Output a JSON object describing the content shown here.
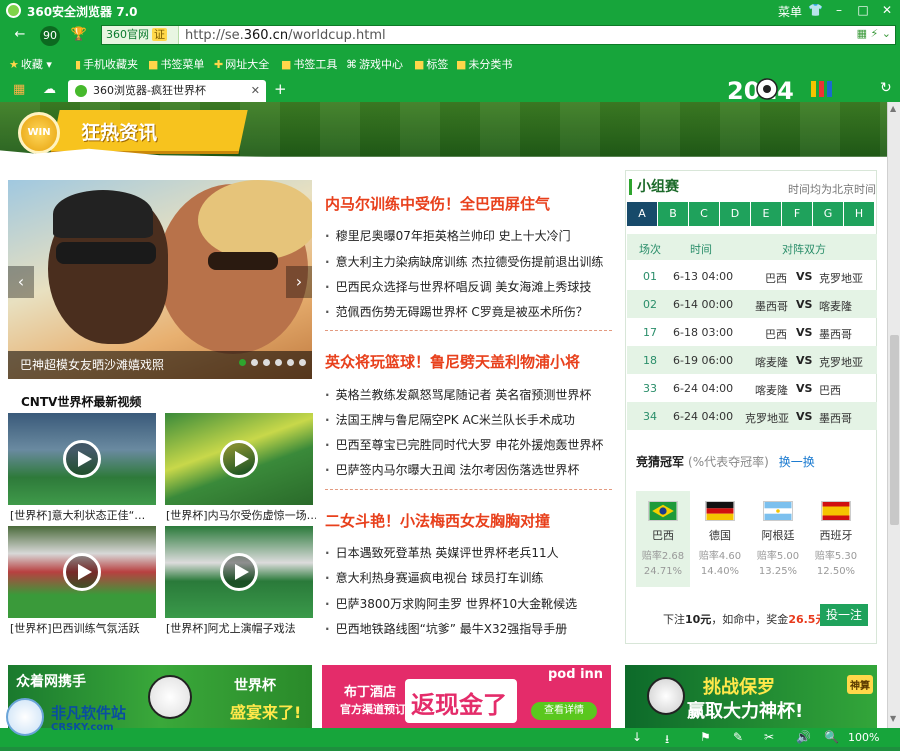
{
  "browser": {
    "title": "360安全浏览器 7.0",
    "menu_label": "菜单",
    "url_site_name": "360官网",
    "url_cert_label": "证",
    "url_prefix": "http://se.",
    "url_domain": "360.cn",
    "url_suffix": "/worldcup.html",
    "tab_title": "360浏览器-疯狂世界杯",
    "zoom": "100%",
    "accent": "#17a53b"
  },
  "bookmarks": [
    {
      "label": "收藏",
      "icon": "star-icon"
    },
    {
      "label": "手机收藏夹",
      "icon": "phone-icon"
    },
    {
      "label": "书签菜单",
      "icon": "folder-icon"
    },
    {
      "label": "网址大全",
      "icon": "plus-icon"
    },
    {
      "label": "书签工具",
      "icon": "folder-icon"
    },
    {
      "label": "游戏中心",
      "icon": "gamepad-icon"
    },
    {
      "label": "标签",
      "icon": "folder-icon"
    },
    {
      "label": "未分类书",
      "icon": "folder-icon"
    }
  ],
  "banner": {
    "title": "狂热资讯",
    "medal": "WIN",
    "wc_year": "2014"
  },
  "slider": {
    "caption": "巴神超模女友晒沙滩嬉戏照",
    "dot_count": 6,
    "active_dot": 1
  },
  "videos": {
    "section_title": "CNTV世界杯最新视频",
    "items": [
      {
        "caption": "[世界杯]意大利状态正佳“…"
      },
      {
        "caption": "[世界杯]内马尔受伤虚惊一场…"
      },
      {
        "caption": "[世界杯]巴西训练气氛活跃"
      },
      {
        "caption": "[世界杯]阿尤上演帽子戏法"
      }
    ]
  },
  "news": [
    {
      "headline": "内马尔训练中受伤！全巴西屏住气",
      "items": [
        "穆里尼奥曝07年拒英格兰帅印 史上十大冷门",
        "意大利主力染病缺席训练 杰拉德受伤提前退出训练",
        "巴西民众选择与世界杯唱反调 美女海滩上秀球技",
        "范佩西伤势无碍踢世界杯 C罗竟是被巫术所伤？"
      ]
    },
    {
      "headline": "英众将玩篮球！鲁尼劈天盖利物浦小将",
      "items": [
        "英格兰教练发飙怒骂尾随记者 英名宿预测世界杯",
        "法国王牌与鲁尼隔空PK AC米兰队长手术成功",
        "巴西至尊宝已完胜同时代大罗 申花外援炮轰世界杯",
        "巴萨签内马尔曝大丑闻 法尔考因伤落选世界杯"
      ]
    },
    {
      "headline": "二女斗艳！小法梅西女友胸胸对撞",
      "items": [
        "日本遇致死登革热 英媒评世界杯老兵11人",
        "意大利热身赛逼疯电视台 球员打车训练",
        "巴萨3800万求购阿圭罗 世界杯10大金靴候选",
        "巴西地铁路线图“坑爹” 最牛X32强指导手册"
      ]
    }
  ],
  "schedule": {
    "title": "小组赛",
    "timezone_note": "时间均为北京时间",
    "groups": [
      "A",
      "B",
      "C",
      "D",
      "E",
      "F",
      "G",
      "H"
    ],
    "active_group": "A",
    "headers": {
      "no": "场次",
      "time": "时间",
      "teams": "对阵双方"
    },
    "matches": [
      {
        "no": "01",
        "time": "6-13 04:00",
        "home": "巴西",
        "away": "克罗地亚"
      },
      {
        "no": "02",
        "time": "6-14 00:00",
        "home": "墨西哥",
        "away": "喀麦隆"
      },
      {
        "no": "17",
        "time": "6-18 03:00",
        "home": "巴西",
        "away": "墨西哥"
      },
      {
        "no": "18",
        "time": "6-19 06:00",
        "home": "喀麦隆",
        "away": "克罗地亚"
      },
      {
        "no": "33",
        "time": "6-24 04:00",
        "home": "喀麦隆",
        "away": "巴西"
      },
      {
        "no": "34",
        "time": "6-24 04:00",
        "home": "克罗地亚",
        "away": "墨西哥"
      }
    ],
    "vs_label": "VS"
  },
  "champion": {
    "title": "竞猜冠军",
    "subtitle": "(%代表夺冠率)",
    "refresh_label": "换一换",
    "teams": [
      {
        "name": "巴西",
        "odds": "赔率2.68",
        "pct": "24.71%",
        "selected": true
      },
      {
        "name": "德国",
        "odds": "赔率4.60",
        "pct": "14.40%",
        "selected": false
      },
      {
        "name": "阿根廷",
        "odds": "赔率5.00",
        "pct": "13.25%",
        "selected": false
      },
      {
        "name": "西班牙",
        "odds": "赔率5.30",
        "pct": "12.50%",
        "selected": false
      }
    ],
    "bet_prefix": "下注",
    "bet_amount": "10元",
    "bet_middle": "，如命中，奖金",
    "bet_prize": "26.5元",
    "bet_button": "投一注"
  },
  "ads": {
    "ad1_line1": "众着网携手",
    "ad1_line2": "世界杯",
    "ad1_line3": "盛宴来了!",
    "ad2_brand": "pod inn",
    "ad2_line1": "布丁酒店",
    "ad2_line2": "官方渠道预订",
    "ad2_big": "返现金了",
    "ad2_btn": "查看详情",
    "ad3_line1": "挑战保罗",
    "ad3_line2": "赢取大力神杯!",
    "ad3_logo": "神算"
  },
  "watermark": {
    "text1": "非凡软件站",
    "text2": "CRSKY.com"
  }
}
